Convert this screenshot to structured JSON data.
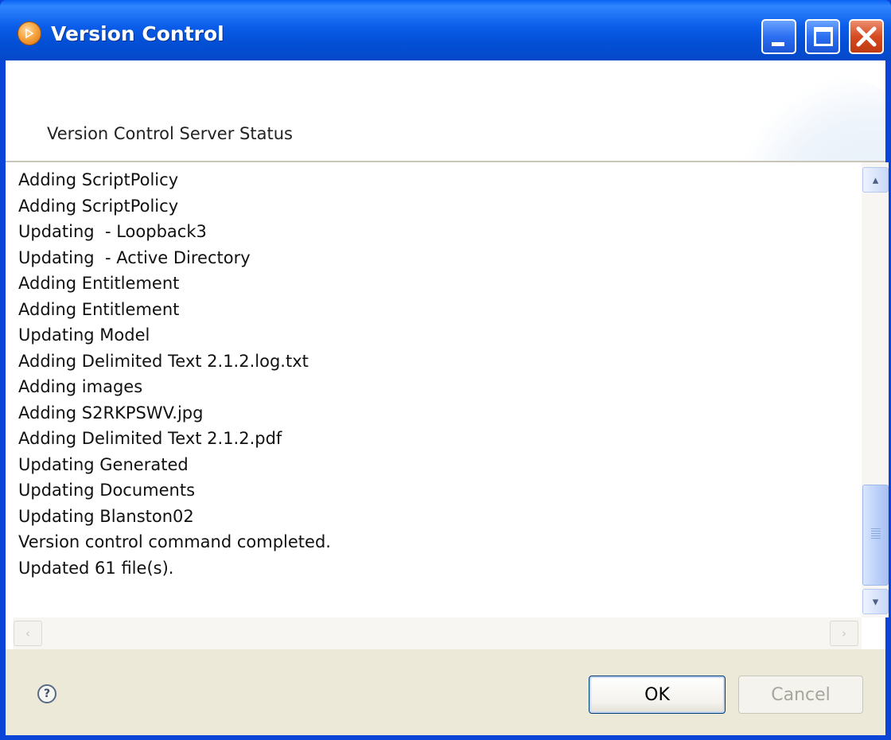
{
  "window": {
    "title": "Version Control"
  },
  "header": {
    "label": "Version Control Server Status"
  },
  "log": {
    "lines": [
      "Adding ScriptPolicy",
      "Adding ScriptPolicy",
      "Updating  - Loopback3",
      "Updating  - Active Directory",
      "Adding Entitlement",
      "Adding Entitlement",
      "Updating Model",
      "Adding Delimited Text 2.1.2.log.txt",
      "Adding images",
      "Adding S2RKPSWV.jpg",
      "Adding Delimited Text 2.1.2.pdf",
      "Updating Generated",
      "Updating Documents",
      "Updating Blanston02",
      "Version control command completed.",
      "Updated 61 file(s)."
    ]
  },
  "footer": {
    "ok_label": "OK",
    "cancel_label": "Cancel"
  },
  "icons": {
    "help": "?",
    "scroll_up": "▴",
    "scroll_down": "▾",
    "scroll_left": "‹",
    "scroll_right": "›"
  },
  "colors": {
    "titlebar": "#0a5ce8",
    "close_button": "#d54b21",
    "footer_bg": "#ece9d8"
  }
}
